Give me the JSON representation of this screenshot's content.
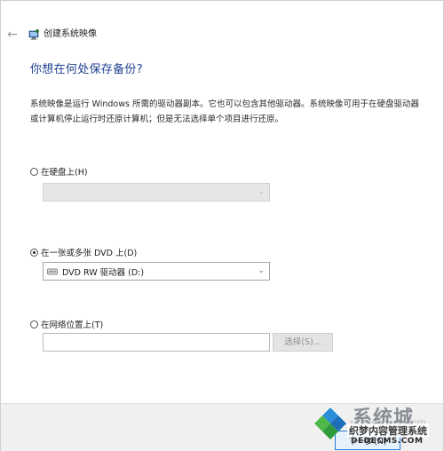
{
  "window": {
    "title": "创建系统映像",
    "back_icon": "back-arrow-icon",
    "app_icon": "system-image-icon"
  },
  "heading": "你想在何处保存备份?",
  "description": "系统映像是运行 Windows 所需的驱动器副本。它也可以包含其他驱动器。系统映像可用于在硬盘驱动器或计算机停止运行时还原计算机；但是无法选择单个项目进行还原。",
  "options": {
    "hard_disk": {
      "label": "在硬盘上(H)",
      "selected": false,
      "dropdown_value": ""
    },
    "dvd": {
      "label": "在一张或多张 DVD 上(D)",
      "selected": true,
      "dropdown_value": "DVD RW 驱动器 (D:)",
      "drive_icon": "dvd-drive-icon"
    },
    "network": {
      "label": "在网络位置上(T)",
      "selected": false,
      "input_value": "",
      "browse_label": "选择(S)..."
    }
  },
  "footer": {
    "next_label": "下一步(N)"
  },
  "watermark": {
    "brand": "系统城",
    "site_cn": "织梦内容管理系统",
    "url": "DEDECMS.COM",
    "faint_text": "xitongcheng.com"
  },
  "colors": {
    "heading": "#1e3f8f",
    "focus_border": "#2a7bd6",
    "disabled_bg": "#e6e6e6"
  }
}
